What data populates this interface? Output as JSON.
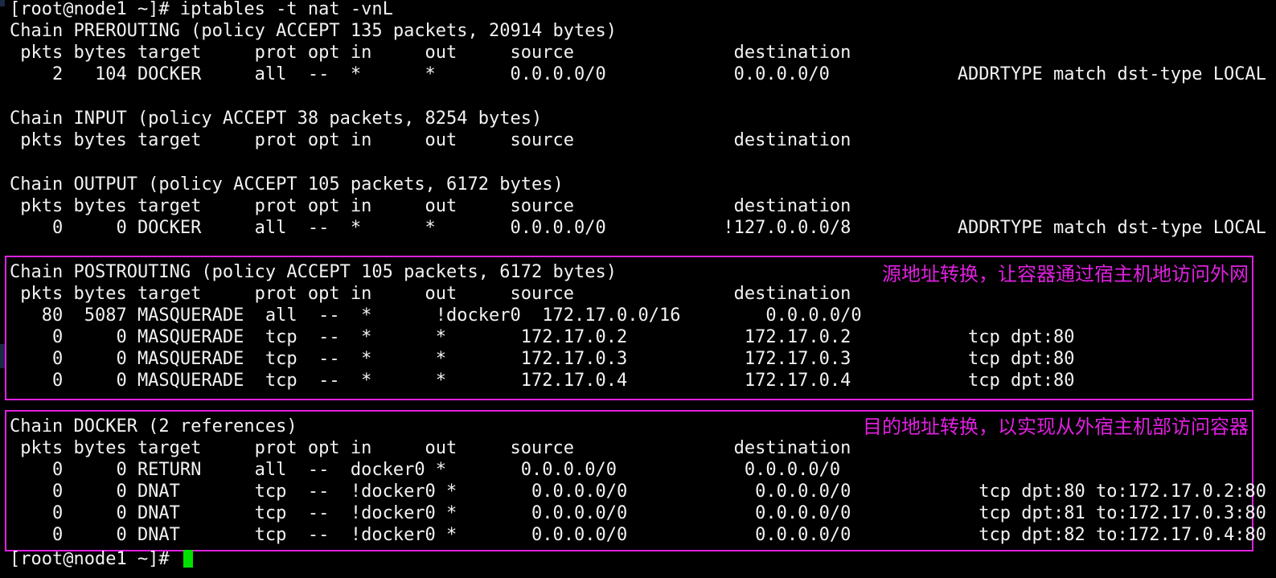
{
  "lines": [
    "[root@node1 ~]# iptables -t nat -vnL",
    "Chain PREROUTING (policy ACCEPT 135 packets, 20914 bytes)",
    " pkts bytes target     prot opt in     out     source               destination         ",
    "    2   104 DOCKER     all  --  *      *       0.0.0.0/0            0.0.0.0/0            ADDRTYPE match dst-type LOCAL",
    "",
    "Chain INPUT (policy ACCEPT 38 packets, 8254 bytes)",
    " pkts bytes target     prot opt in     out     source               destination         ",
    "",
    "Chain OUTPUT (policy ACCEPT 105 packets, 6172 bytes)",
    " pkts bytes target     prot opt in     out     source               destination         ",
    "    0     0 DOCKER     all  --  *      *       0.0.0.0/0           !127.0.0.0/8          ADDRTYPE match dst-type LOCAL",
    "",
    "Chain POSTROUTING (policy ACCEPT 105 packets, 6172 bytes)",
    " pkts bytes target     prot opt in     out     source               destination         ",
    "   80  5087 MASQUERADE  all  --  *      !docker0  172.17.0.0/16        0.0.0.0/0           ",
    "    0     0 MASQUERADE  tcp  --  *      *       172.17.0.2           172.17.0.2           tcp dpt:80",
    "    0     0 MASQUERADE  tcp  --  *      *       172.17.0.3           172.17.0.3           tcp dpt:80",
    "    0     0 MASQUERADE  tcp  --  *      *       172.17.0.4           172.17.0.4           tcp dpt:80",
    "",
    "Chain DOCKER (2 references)",
    " pkts bytes target     prot opt in     out     source               destination         ",
    "    0     0 RETURN     all  --  docker0 *       0.0.0.0/0            0.0.0.0/0           ",
    "    0     0 DNAT       tcp  --  !docker0 *       0.0.0.0/0            0.0.0.0/0            tcp dpt:80 to:172.17.0.2:80",
    "    0     0 DNAT       tcp  --  !docker0 *       0.0.0.0/0            0.0.0.0/0            tcp dpt:81 to:172.17.0.3:80",
    "    0     0 DNAT       tcp  --  !docker0 *       0.0.0.0/0            0.0.0.0/0            tcp dpt:82 to:172.17.0.4:80",
    "[root@node1 ~]# "
  ],
  "annotations": {
    "postrouting_note": "源地址转换，让容器通过宿主机地访问外网",
    "docker_note": "目的地址转换，以实现从外宿主机部访问容器"
  },
  "colors": {
    "background": "#000000",
    "text": "#f2f2f2",
    "annotation": "#e020e0",
    "cursor": "#00e000"
  }
}
